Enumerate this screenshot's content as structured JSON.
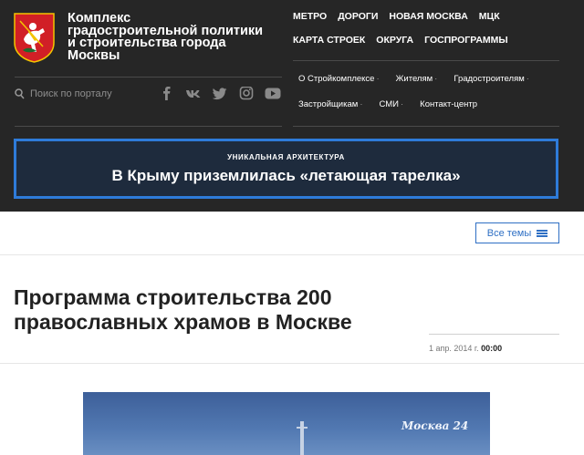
{
  "header": {
    "logo_text": "Комплекс градостроительной политики и строительства города Москвы",
    "top_nav": [
      [
        "МЕТРО",
        "ДОРОГИ",
        "НОВАЯ МОСКВА",
        "МЦК"
      ],
      [
        "КАРТА СТРОЕК",
        "ОКРУГА",
        "ГОСПРОГРАММЫ"
      ]
    ],
    "search_placeholder": "Поиск по порталу",
    "social_icons": [
      "facebook-icon",
      "vk-icon",
      "twitter-icon",
      "instagram-icon",
      "youtube-icon"
    ],
    "sub_nav": [
      [
        "О Стройкомплексе",
        "Жителям",
        "Градостроителям"
      ],
      [
        "Застройщикам",
        "СМИ",
        "Контакт-центр"
      ]
    ],
    "dropdown_marker": "·",
    "colors": {
      "header_bg": "#262626",
      "accent": "#2e7bd9",
      "banner_bg": "#1e2b3d"
    }
  },
  "banner": {
    "kicker": "УНИКАЛЬНАЯ АРХИТЕКТУРА",
    "title": "В Крыму приземлилась «летающая тарелка»"
  },
  "topics_button": {
    "label": "Все темы"
  },
  "article": {
    "title": "Программа строительства 200 православных храмов в Москве",
    "date": "1 апр. 2014 г.",
    "time": "00:00"
  },
  "photo": {
    "watermark": "Москва 24"
  }
}
